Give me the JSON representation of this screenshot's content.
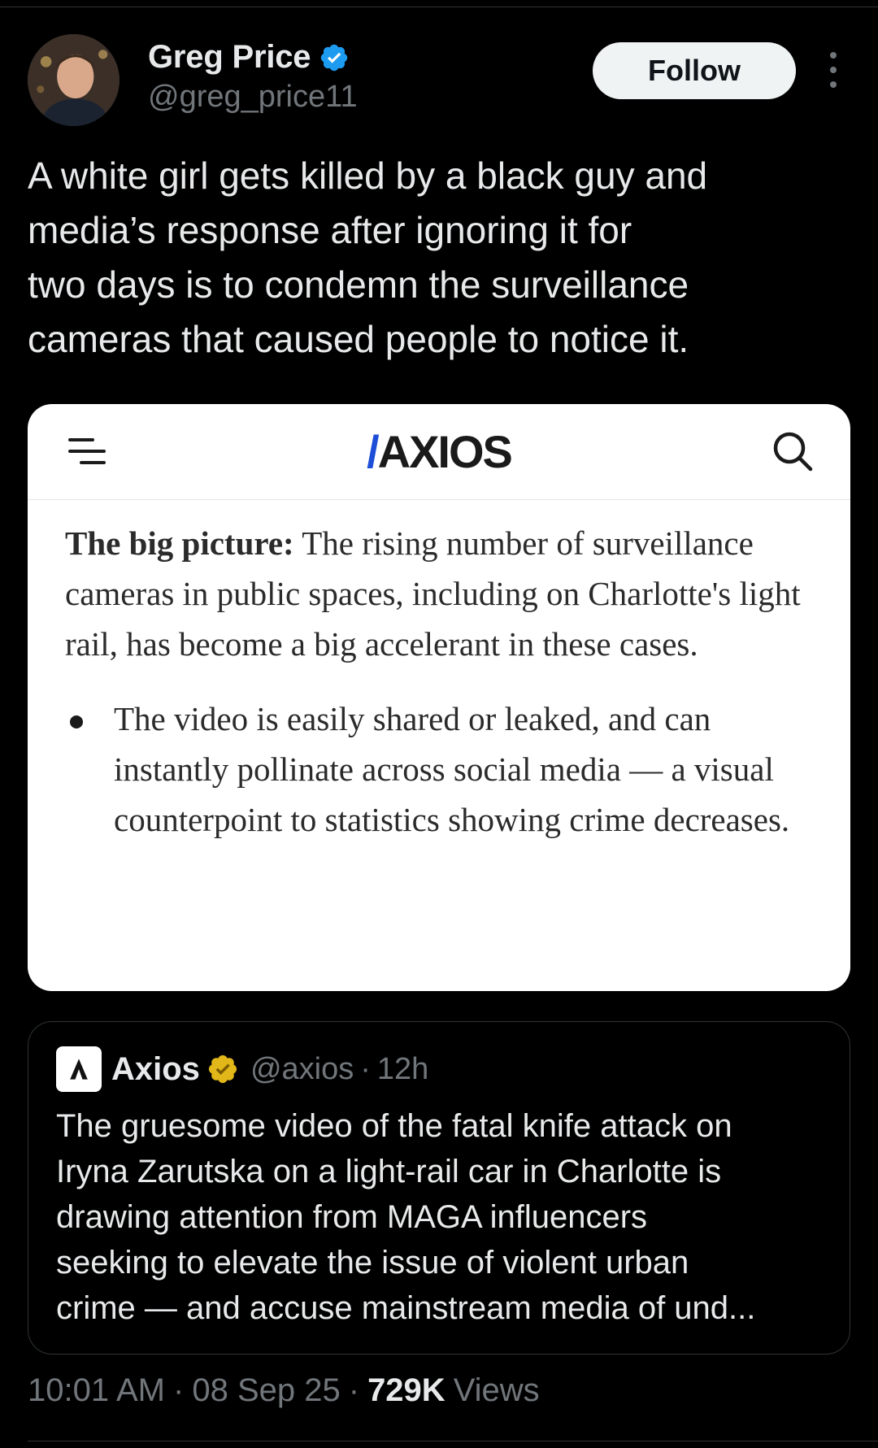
{
  "author": {
    "display_name": "Greg Price",
    "handle": "@greg_price11",
    "verified": true,
    "verified_color": "#1d9bf0",
    "avatar_icon": "profile-photo"
  },
  "actions": {
    "follow_label": "Follow",
    "more_icon": "more-vertical-icon"
  },
  "tweet": {
    "text": "A white girl gets killed by a black guy and\nmedia’s response after ignoring it for\ntwo days is to condemn the surveillance\ncameras that caused people to notice it."
  },
  "media": {
    "site_logo": "AXIOS",
    "site_logo_accent": "#1d4ed8",
    "menu_icon": "menu-icon",
    "search_icon": "search-icon",
    "lead_bold": "The big picture:",
    "lead_text": " The rising number of surveillance cameras in public spaces, including on Charlotte's light rail, has become a big accelerant in these cases.",
    "bullet_text": "The video is easily shared or leaked, and can instantly pollinate across social media — a visual counterpoint to statistics showing crime decreases."
  },
  "quote": {
    "name": "Axios",
    "handle": "@axios",
    "separator": "·",
    "time": "12h",
    "badge_color": "#e2b719",
    "text": "The gruesome video of the fatal knife attack on\nIryna Zarutska on a light-rail car in Charlotte is\ndrawing attention from MAGA influencers\nseeking to elevate the issue of violent urban\ncrime — and accuse mainstream media of und..."
  },
  "meta": {
    "time": "10:01 AM",
    "separator": "·",
    "date": "08 Sep 25",
    "views_count": "729K",
    "views_label": "Views"
  }
}
